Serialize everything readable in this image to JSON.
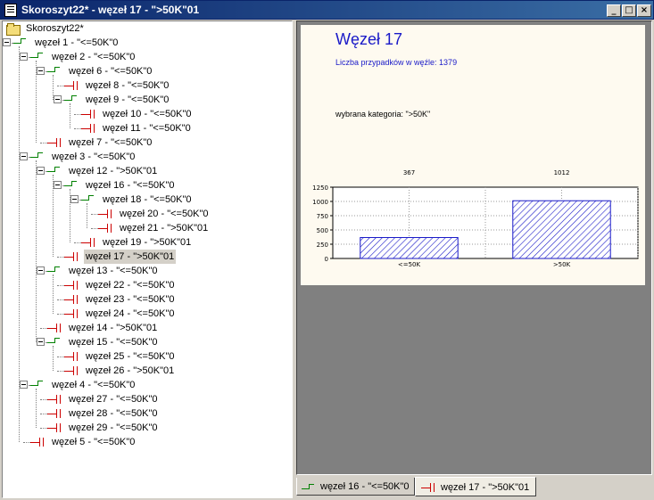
{
  "window": {
    "title": "Skoroszyt22* - węzeł 17 - \">50K\"01",
    "buttons": [
      "_",
      "□",
      "×"
    ]
  },
  "tree": {
    "root_label": "Skoroszyt22*",
    "nodes": [
      {
        "label": "węzeł 1 - \"<=50K\"0",
        "type": "split",
        "depth": 0
      },
      {
        "label": "węzeł 2 - \"<=50K\"0",
        "type": "split",
        "depth": 1
      },
      {
        "label": "węzeł 6 - \"<=50K\"0",
        "type": "split",
        "depth": 2
      },
      {
        "label": "węzeł 8 - \"<=50K\"0",
        "type": "leaf",
        "depth": 3
      },
      {
        "label": "węzeł 9 - \"<=50K\"0",
        "type": "split",
        "depth": 3
      },
      {
        "label": "węzeł 10 - \"<=50K\"0",
        "type": "leaf",
        "depth": 4
      },
      {
        "label": "węzeł 11 - \"<=50K\"0",
        "type": "leaf",
        "depth": 4
      },
      {
        "label": "węzeł 7 - \"<=50K\"0",
        "type": "leaf",
        "depth": 2
      },
      {
        "label": "węzeł 3 - \"<=50K\"0",
        "type": "split",
        "depth": 1
      },
      {
        "label": "węzeł 12 - \">50K\"01",
        "type": "split",
        "depth": 2
      },
      {
        "label": "węzeł 16 - \"<=50K\"0",
        "type": "split",
        "depth": 3
      },
      {
        "label": "węzeł 18 - \"<=50K\"0",
        "type": "split",
        "depth": 4
      },
      {
        "label": "węzeł 20 - \"<=50K\"0",
        "type": "leaf",
        "depth": 5
      },
      {
        "label": "węzeł 21 - \">50K\"01",
        "type": "leaf",
        "depth": 5
      },
      {
        "label": "węzeł 19 - \">50K\"01",
        "type": "leaf",
        "depth": 4
      },
      {
        "label": "węzeł 17 - \">50K\"01",
        "type": "leaf",
        "depth": 3,
        "selected": true
      },
      {
        "label": "węzeł 13 - \"<=50K\"0",
        "type": "split",
        "depth": 2
      },
      {
        "label": "węzeł 22 - \"<=50K\"0",
        "type": "leaf",
        "depth": 3
      },
      {
        "label": "węzeł 23 - \"<=50K\"0",
        "type": "leaf",
        "depth": 3
      },
      {
        "label": "węzeł 24 - \"<=50K\"0",
        "type": "leaf",
        "depth": 3
      },
      {
        "label": "węzeł 14 - \">50K\"01",
        "type": "leaf",
        "depth": 2
      },
      {
        "label": "węzeł 15 - \"<=50K\"0",
        "type": "split",
        "depth": 2
      },
      {
        "label": "węzeł 25 - \"<=50K\"0",
        "type": "leaf",
        "depth": 3
      },
      {
        "label": "węzeł 26 - \">50K\"01",
        "type": "leaf",
        "depth": 3
      },
      {
        "label": "węzeł 4 - \"<=50K\"0",
        "type": "split",
        "depth": 1
      },
      {
        "label": "węzeł 27 - \"<=50K\"0",
        "type": "leaf",
        "depth": 2
      },
      {
        "label": "węzeł 28 - \"<=50K\"0",
        "type": "leaf",
        "depth": 2
      },
      {
        "label": "węzeł 29 - \"<=50K\"0",
        "type": "leaf",
        "depth": 2
      },
      {
        "label": "węzeł 5 - \"<=50K\"0",
        "type": "leaf",
        "depth": 1
      }
    ]
  },
  "report": {
    "node_title": "Węzeł 17",
    "cases_line": "Liczba przypadków w węźle: 1379",
    "category_line": "wybrana kategoria: \">50K\""
  },
  "chart_data": {
    "type": "bar",
    "categories": [
      "<=50K",
      ">50K"
    ],
    "values": [
      367,
      1012
    ],
    "ylim": [
      0,
      1250
    ],
    "yticks": [
      0,
      250,
      500,
      750,
      1000,
      1250
    ],
    "grid": true,
    "title": "",
    "xlabel": "",
    "ylabel": ""
  },
  "tabs": [
    {
      "label": "węzeł 16 - \"<=50K\"0",
      "icon": "split-node-icon",
      "active": false
    },
    {
      "label": "węzeł 17 - \">50K\"01",
      "icon": "leaf-node-icon",
      "active": true
    }
  ],
  "colors": {
    "split_icon": "#008000",
    "leaf_icon": "#cc0000",
    "title_blue": "#1a1ac8",
    "bar_fill": "#1a1ac8"
  }
}
